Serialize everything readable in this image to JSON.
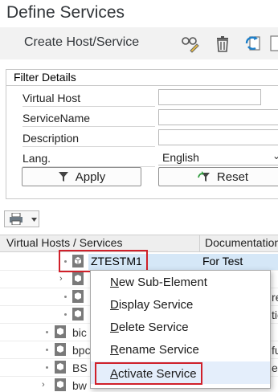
{
  "window": {
    "title": "Define Services"
  },
  "toolbar": {
    "create_label": "Create Host/Service"
  },
  "filter": {
    "title": "Filter Details",
    "fields": [
      {
        "label": "Virtual Host",
        "value": ""
      },
      {
        "label": "ServiceName",
        "value": ""
      },
      {
        "label": "Description",
        "value": ""
      },
      {
        "label": "Lang.",
        "value": "English"
      }
    ],
    "apply_label": "Apply",
    "reset_label": "Reset"
  },
  "grid": {
    "columns": [
      "Virtual Hosts / Services",
      "Documentation"
    ],
    "selected_row": {
      "name": "ZTESTM1",
      "documentation": "For Test"
    },
    "partial_rows": [
      {
        "name": "bic",
        "doc": ""
      },
      {
        "name": "bpc",
        "doc": ""
      },
      {
        "name": "BS",
        "doc": ""
      },
      {
        "name": "bw",
        "doc": ""
      }
    ],
    "doc_fragments": [
      "rea",
      "tio",
      "fu",
      "e"
    ]
  },
  "context_menu": {
    "items": [
      {
        "label": "New Sub-Element",
        "underline": "N",
        "rest": "ew Sub-Element"
      },
      {
        "label": "Display Service",
        "underline": "D",
        "rest": "isplay Service"
      },
      {
        "label": "Delete Service",
        "underline": "D",
        "rest": "elete Service"
      },
      {
        "label": "Rename Service",
        "underline": "R",
        "rest": "ename Service"
      },
      {
        "label": "Activate Service",
        "underline": "A",
        "rest": "ctivate Service"
      }
    ]
  },
  "colors": {
    "highlight": "#d0202a",
    "selection": "#d5e7f7"
  }
}
